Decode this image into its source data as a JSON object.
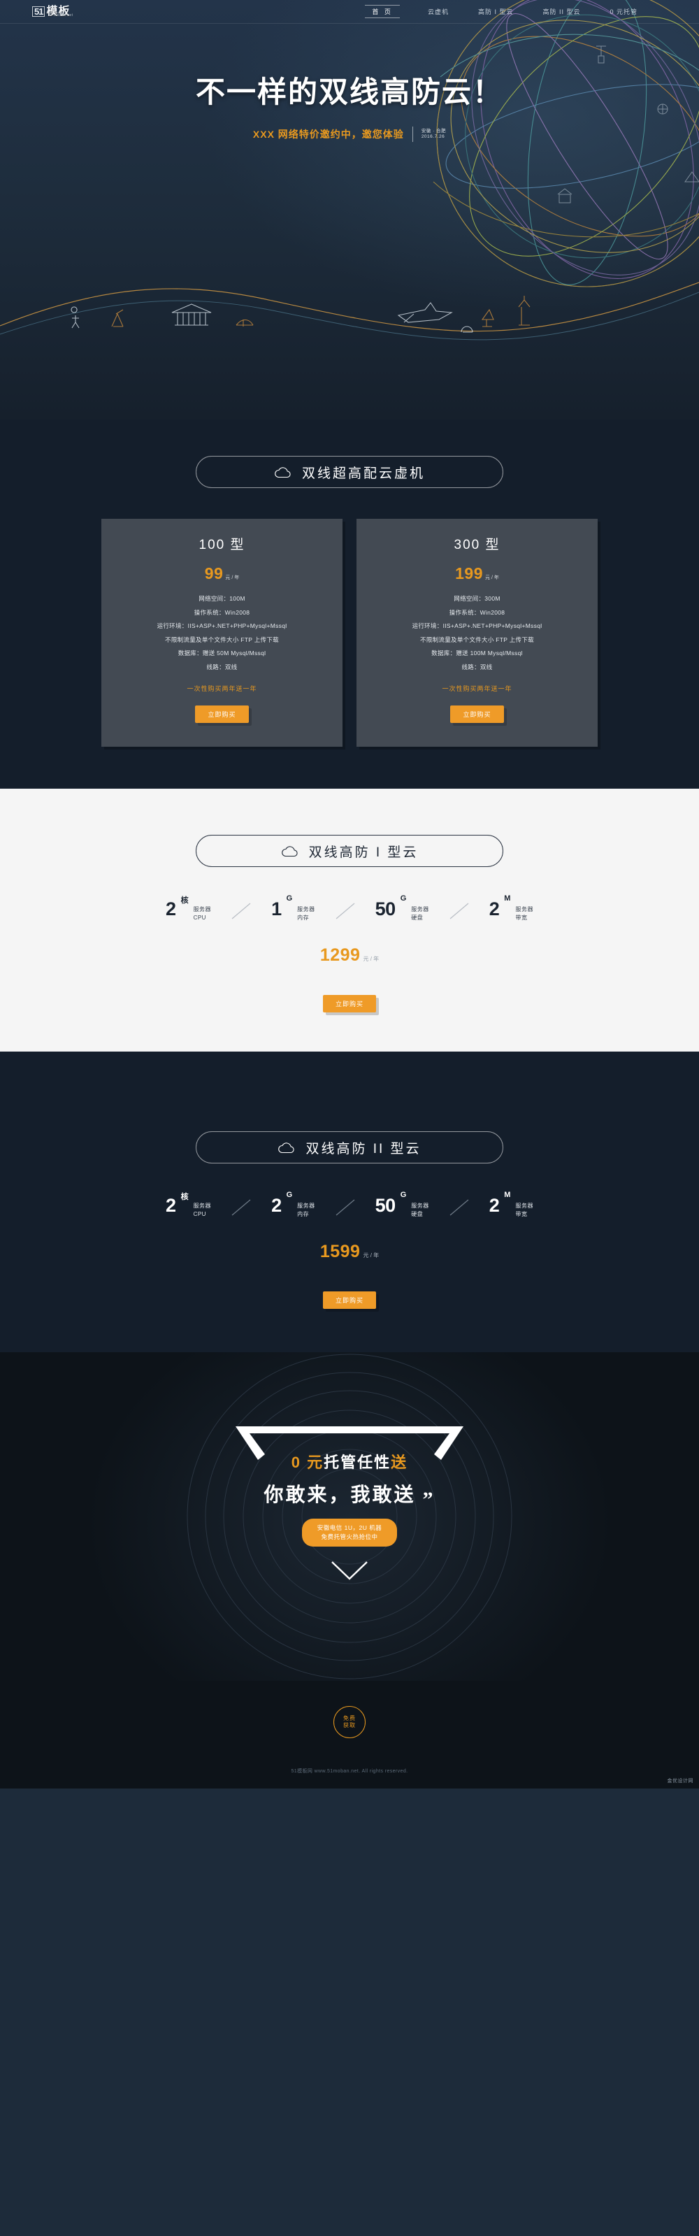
{
  "nav": {
    "logo": {
      "mark": "51",
      "name": "模板",
      "domain": "moban.net"
    },
    "links": [
      {
        "label": "首 页",
        "active": true
      },
      {
        "label": "云虚机",
        "active": false
      },
      {
        "label": "高防 I 型云",
        "active": false
      },
      {
        "label": "高防 II 型云",
        "active": false
      },
      {
        "label": "0 元托管",
        "active": false
      }
    ]
  },
  "hero": {
    "title": "不一样的双线高防云！",
    "subtitle": "XXX 网络特价邀约中，邀您体验",
    "location": "安徽 · 合肥",
    "date": "2016.7.26"
  },
  "vm_section": {
    "heading": "双线超高配云虚机",
    "icon": "cloud-icon",
    "cards": [
      {
        "title": "100 型",
        "price": "99",
        "price_unit": "元 / 年",
        "specs": [
          "网络空间：100M",
          "操作系统：Win2008",
          "运行环境：IIS+ASP+.NET+PHP+Mysql+Mssql",
          "不限制流量及单个文件大小 FTP 上传下载",
          "数据库：赠送 50M Mysql/Mssql",
          "线路：双线"
        ],
        "promo": "一次性购买两年送一年",
        "buy_label": "立即购买"
      },
      {
        "title": "300 型",
        "price": "199",
        "price_unit": "元 / 年",
        "specs": [
          "网络空间：300M",
          "操作系统：Win2008",
          "运行环境：IIS+ASP+.NET+PHP+Mysql+Mssql",
          "不限制流量及单个文件大小 FTP 上传下载",
          "数据库：赠送 100M Mysql/Mssql",
          "线路：双线"
        ],
        "promo": "一次性购买两年送一年",
        "buy_label": "立即购买"
      }
    ]
  },
  "cloud1": {
    "heading": "双线高防 I 型云",
    "icon": "cloud-icon",
    "specs": [
      {
        "num": "2",
        "sup": "核",
        "label1": "服务器",
        "label2": "CPU"
      },
      {
        "num": "1",
        "sup": "G",
        "label1": "服务器",
        "label2": "内存"
      },
      {
        "num": "50",
        "sup": "G",
        "label1": "服务器",
        "label2": "硬盘"
      },
      {
        "num": "2",
        "sup": "M",
        "label1": "服务器",
        "label2": "带宽"
      }
    ],
    "price": "1299",
    "price_unit": "元 / 年",
    "buy_label": "立即购买"
  },
  "cloud2": {
    "heading": "双线高防 II 型云",
    "icon": "cloud-icon",
    "specs": [
      {
        "num": "2",
        "sup": "核",
        "label1": "服务器",
        "label2": "CPU"
      },
      {
        "num": "2",
        "sup": "G",
        "label1": "服务器",
        "label2": "内存"
      },
      {
        "num": "50",
        "sup": "G",
        "label1": "服务器",
        "label2": "硬盘"
      },
      {
        "num": "2",
        "sup": "M",
        "label1": "服务器",
        "label2": "带宽"
      }
    ],
    "price": "1599",
    "price_unit": "元 / 年",
    "buy_label": "立即购买"
  },
  "promo": {
    "line1_a": "0 元",
    "line1_b": "托管任性",
    "line1_c": "送",
    "line2": "你敢来，我敢送",
    "btn_line1": "安徽电信 1U，2U 机器",
    "btn_line2": "免费托管火热抢位中",
    "circle_line1": "免费",
    "circle_line2": "获取"
  },
  "footer": {
    "text": "51模板网 www.51moban.net. All rights reserved.",
    "corner": "金优设计网"
  },
  "colors": {
    "accent": "#e8991f",
    "button": "#ef9b28",
    "dark_bg": "#141e2b",
    "hero_bg": "#1e2d3d",
    "light_bg": "#f5f5f5",
    "card_bg": "#434a53",
    "promo_bg": "#0d1319"
  }
}
